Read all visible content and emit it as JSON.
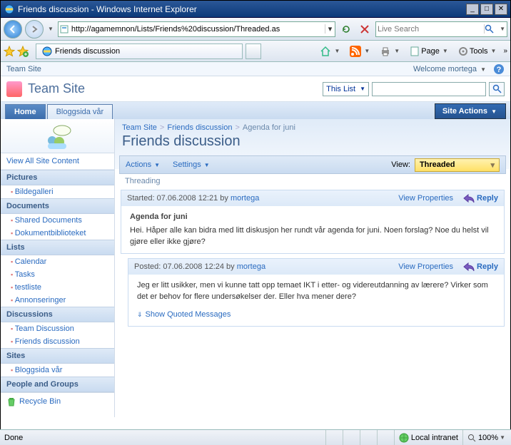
{
  "window": {
    "title": "Friends discussion - Windows Internet Explorer",
    "url": "http://agamemnon/Lists/Friends%20discussion/Threaded.as",
    "search_placeholder": "Live Search",
    "tab_title": "Friends discussion",
    "status": "Done",
    "zone": "Local intranet",
    "zoom": "100%"
  },
  "ie_menu": {
    "page": "Page",
    "tools": "Tools"
  },
  "sp": {
    "topsite": "Team Site",
    "welcome": "Welcome mortega",
    "site_title": "Team Site",
    "scope": "This List",
    "tab_home": "Home",
    "tab_blog": "Bloggsida vår",
    "site_actions": "Site Actions"
  },
  "leftnav": {
    "viewall": "View All Site Content",
    "groups": [
      {
        "head": "Pictures",
        "items": [
          "Bildegalleri"
        ]
      },
      {
        "head": "Documents",
        "items": [
          "Shared Documents",
          "Dokumentbiblioteket"
        ]
      },
      {
        "head": "Lists",
        "items": [
          "Calendar",
          "Tasks",
          "testliste",
          "Annonseringer"
        ]
      },
      {
        "head": "Discussions",
        "items": [
          "Team Discussion",
          "Friends discussion"
        ]
      },
      {
        "head": "Sites",
        "items": [
          "Bloggsida vår"
        ]
      },
      {
        "head": "People and Groups",
        "items": []
      }
    ],
    "recycle": "Recycle Bin"
  },
  "breadcrumb": {
    "a": "Team Site",
    "b": "Friends discussion",
    "c": "Agenda for juni"
  },
  "page_title": "Friends discussion",
  "toolbar": {
    "actions": "Actions",
    "settings": "Settings",
    "view_label": "View:",
    "view_value": "Threaded"
  },
  "thread_label": "Threading",
  "posts": [
    {
      "meta_prefix": "Started: 07.06.2008 12:21 by ",
      "author": "mortega",
      "viewprops": "View Properties",
      "reply": "Reply",
      "title": "Agenda for juni",
      "body": "Hei. Håper alle kan bidra med litt diskusjon her rundt vår agenda for juni. Noen forslag? Noe du helst vil gjøre eller ikke gjøre?"
    },
    {
      "meta_prefix": "Posted: 07.06.2008 12:24 by ",
      "author": "mortega",
      "viewprops": "View Properties",
      "reply": "Reply",
      "body": "Jeg er litt usikker, men vi kunne tatt opp temaet IKT i etter- og videreutdanning av lærere? Virker som det er behov for flere undersøkelser der. Eller hva mener dere?",
      "quoted": "Show Quoted Messages"
    }
  ]
}
